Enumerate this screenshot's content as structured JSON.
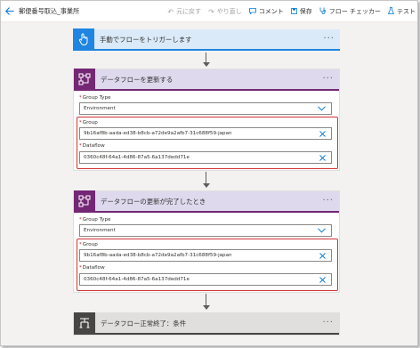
{
  "header": {
    "back_icon": "back-arrow-icon",
    "flow_name": "郵便番号取込_事業所",
    "undo_label": "元に戻す",
    "redo_label": "やり直し",
    "comment_label": "コメント",
    "save_label": "保存",
    "flow_checker_label": "フロー チェッカー",
    "test_label": "テスト"
  },
  "trigger": {
    "title": "手動でフローをトリガーします",
    "icon": "touch-hand-icon",
    "more": "···"
  },
  "action1": {
    "title": "データフローを更新する",
    "icon": "dataflow-icon",
    "more": "···",
    "group_type_label": "Group Type",
    "group_type_value": "Environment",
    "group_label": "Group",
    "group_value": "9b16af8b-aada-ed38-b8cb-a72de9a2afb7-31c688f59-japan",
    "dataflow_label": "Dataflow",
    "dataflow_value": "0360c48f-64a1-4d86-87a5-6a137dedd71e"
  },
  "action2": {
    "title": "データフローの更新が完了したとき",
    "icon": "dataflow-icon",
    "more": "···",
    "group_type_label": "Group Type",
    "group_type_value": "Environment",
    "group_label": "Group",
    "group_value": "9b16af8b-aada-ed38-b8cb-a72de9a2afb7-31c688f59-japan",
    "dataflow_label": "Dataflow",
    "dataflow_value": "0360c48f-64a1-4d86-87a5-6a137dedd71e"
  },
  "condition": {
    "title": "データフロー正常終了：条件",
    "icon": "condition-icon",
    "more": "···"
  },
  "required_mark": "*",
  "colors": {
    "accent": "#0078d4",
    "trigger": "#1f85e0",
    "dataflow": "#742774",
    "condition": "#484644",
    "highlight": "#d13438"
  }
}
